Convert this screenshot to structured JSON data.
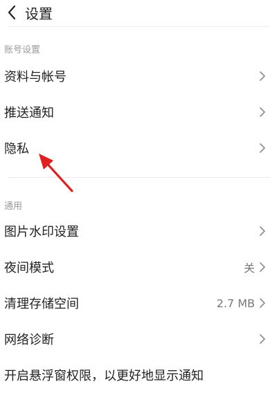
{
  "header": {
    "back_icon": "chevron-left-icon",
    "title": "设置"
  },
  "sections": {
    "account": {
      "label": "账号设置",
      "items": {
        "profile": {
          "label": "资料与帐号"
        },
        "push": {
          "label": "推送通知"
        },
        "privacy": {
          "label": "隐私"
        }
      }
    },
    "general": {
      "label": "通用",
      "items": {
        "watermark": {
          "label": "图片水印设置"
        },
        "night_mode": {
          "label": "夜间模式",
          "value": "关"
        },
        "storage": {
          "label": "清理存储空间",
          "value": "2.7 MB"
        },
        "network": {
          "label": "网络诊断"
        },
        "floating": {
          "label": "开启悬浮窗权限，以更好地显示通知"
        }
      }
    }
  },
  "annotation": {
    "color": "#e02020"
  },
  "colors": {
    "text": "#222222",
    "muted": "#9a9a9a",
    "chevron": "#8a8a8a",
    "divider": "#ececec"
  }
}
